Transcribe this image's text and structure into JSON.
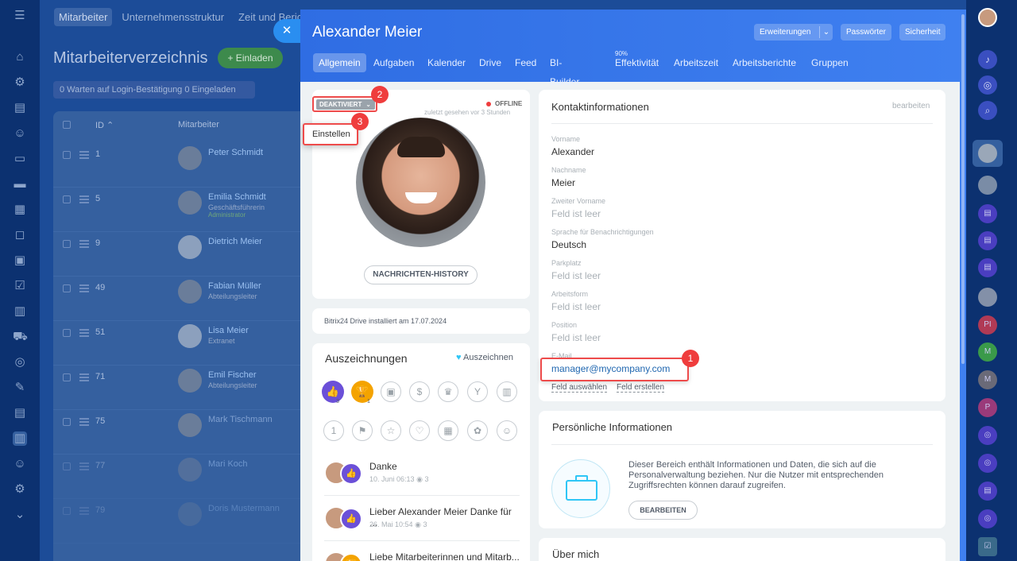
{
  "background": {
    "topnav": [
      "Mitarbeiter",
      "Unternehmensstruktur",
      "Zeit und Berichte"
    ],
    "page_title": "Mitarbeiterverzeichnis",
    "invite_label": "+ Einladen",
    "filters": "0 Warten auf Login-Bestätigung   0 Eingeladen",
    "col_id": "ID ⌃",
    "col_employee": "Mitarbeiter",
    "rows": [
      {
        "id": "1",
        "name": "Peter Schmidt",
        "sub": "",
        "sub2": ""
      },
      {
        "id": "5",
        "name": "Emilia Schmidt",
        "sub": "Geschäftsführerin",
        "sub2": "Administrator"
      },
      {
        "id": "9",
        "name": "Dietrich Meier",
        "sub": "",
        "sub2": ""
      },
      {
        "id": "49",
        "name": "Fabian Müller",
        "sub": "Abteilungsleiter",
        "sub2": ""
      },
      {
        "id": "51",
        "name": "Lisa Meier",
        "sub": "Extranet",
        "sub2": ""
      },
      {
        "id": "71",
        "name": "Emil Fischer",
        "sub": "Abteilungsleiter",
        "sub2": ""
      },
      {
        "id": "75",
        "name": "Mark Tischmann",
        "sub": "",
        "sub2": ""
      },
      {
        "id": "77",
        "name": "Mari Koch",
        "sub": "",
        "sub2": ""
      },
      {
        "id": "79",
        "name": "Doris Mustermann",
        "sub": "",
        "sub2": ""
      }
    ]
  },
  "panel": {
    "name": "Alexander Meier",
    "buttons": {
      "extensions": "Erweiterungen",
      "passwords": "Passwörter",
      "security": "Sicherheit"
    },
    "tabs": [
      "Allgemein",
      "Aufgaben",
      "Kalender",
      "Drive",
      "Feed",
      "BI-Builder ⌄",
      "Effektivität",
      "Arbeitszeit",
      "Arbeitsberichte",
      "Gruppen"
    ],
    "effectiveness_pct": "90%"
  },
  "profile": {
    "status": "DEAKTIVIERT",
    "online": "OFFLINE",
    "last_seen": "zuletzt gesehen vor 3 Stunden",
    "dropdown_item": "Einstellen",
    "history_button": "NACHRICHTEN-HISTORY",
    "drive_info": "Bitrix24 Drive installiert am 17.07.2024"
  },
  "awards": {
    "title": "Auszeichnungen",
    "action": "Auszeichnen",
    "count_like": "3",
    "count_trophy": "1",
    "items": [
      {
        "title": "Danke",
        "date": "10. Juni 06:13",
        "views": "3"
      },
      {
        "title": "Lieber Alexander Meier Danke für ...",
        "date": "26. Mai 10:54",
        "views": "3"
      },
      {
        "title": "Liebe Mitarbeiterinnen und Mitarb...",
        "date": "",
        "views": ""
      }
    ]
  },
  "contact": {
    "title": "Kontaktinformationen",
    "edit": "bearbeiten",
    "fields": [
      {
        "label": "Vorname",
        "value": "Alexander",
        "empty": false
      },
      {
        "label": "Nachname",
        "value": "Meier",
        "empty": false
      },
      {
        "label": "Zweiter Vorname",
        "value": "Feld ist leer",
        "empty": true
      },
      {
        "label": "Sprache für Benachrichtigungen",
        "value": "Deutsch",
        "empty": false
      },
      {
        "label": "Parkplatz",
        "value": "Feld ist leer",
        "empty": true
      },
      {
        "label": "Arbeitsform",
        "value": "Feld ist leer",
        "empty": true
      },
      {
        "label": "Position",
        "value": "Feld ist leer",
        "empty": true
      },
      {
        "label": "E-Mail",
        "value": "manager@mycompany.com",
        "empty": false
      }
    ],
    "select_field": "Feld auswählen",
    "create_field": "Feld erstellen"
  },
  "personal": {
    "title": "Persönliche Informationen",
    "text": "Dieser Bereich enthält Informationen und Daten, die sich auf die Personalverwaltung beziehen. Nur die Nutzer mit entsprechenden Zugriffsrechten können darauf zugreifen.",
    "button": "BEARBEITEN"
  },
  "about": {
    "title": "Über mich"
  },
  "badges": [
    "1",
    "2",
    "3"
  ],
  "rightbar": [
    "PI",
    "M",
    "M",
    "P"
  ],
  "colors": {
    "accent": "#2f6de3",
    "badge": "#ef3d3d",
    "link": "#2067b0"
  }
}
